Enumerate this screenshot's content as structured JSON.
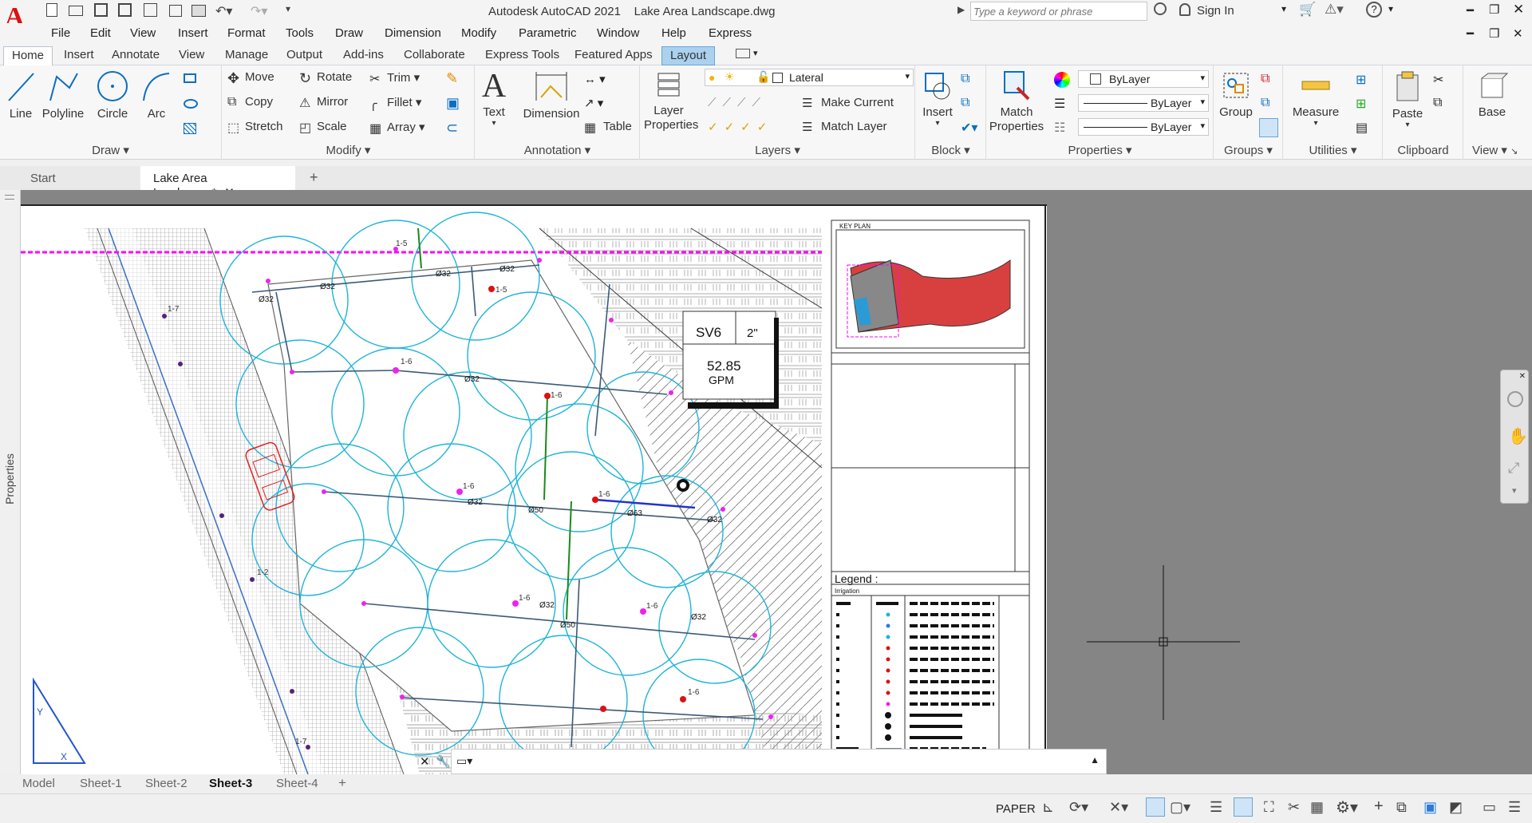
{
  "title_bar": {
    "app_title": "Autodesk AutoCAD 2021",
    "file_name": "Lake Area Landscape.dwg",
    "search_placeholder": "Type a keyword or phrase",
    "sign_in": "Sign In"
  },
  "menu": [
    "File",
    "Edit",
    "View",
    "Insert",
    "Format",
    "Tools",
    "Draw",
    "Dimension",
    "Modify",
    "Parametric",
    "Window",
    "Help",
    "Express"
  ],
  "ribbon_tabs": [
    "Home",
    "Insert",
    "Annotate",
    "View",
    "Manage",
    "Output",
    "Add-ins",
    "Collaborate",
    "Express Tools",
    "Featured Apps",
    "Layout"
  ],
  "ribbon": {
    "draw": {
      "title": "Draw",
      "line": "Line",
      "polyline": "Polyline",
      "circle": "Circle",
      "arc": "Arc"
    },
    "modify": {
      "title": "Modify",
      "move": "Move",
      "rotate": "Rotate",
      "trim": "Trim",
      "copy": "Copy",
      "mirror": "Mirror",
      "fillet": "Fillet",
      "stretch": "Stretch",
      "scale": "Scale",
      "array": "Array"
    },
    "annotation": {
      "title": "Annotation",
      "text": "Text",
      "dimension": "Dimension",
      "table": "Table"
    },
    "layers": {
      "title": "Layers",
      "layer_properties": "Layer Properties",
      "current_layer": "Lateral",
      "make_current": "Make Current",
      "match_layer": "Match Layer"
    },
    "block": {
      "title": "Block",
      "insert": "Insert"
    },
    "properties": {
      "title": "Properties",
      "match_properties": "Match Properties",
      "color": "ByLayer",
      "linetype": "ByLayer",
      "lineweight": "ByLayer"
    },
    "groups": {
      "title": "Groups",
      "group": "Group"
    },
    "utilities": {
      "title": "Utilities",
      "measure": "Measure"
    },
    "clipboard": {
      "title": "Clipboard",
      "paste": "Paste"
    },
    "view": {
      "title": "View",
      "base": "Base"
    }
  },
  "file_tabs": {
    "start": "Start",
    "document": "Lake Area Landscape*"
  },
  "side_panel": "Properties",
  "drawing": {
    "key_plan": "KEY PLAN",
    "legend": "Legend :",
    "legend_sub": "Irrigation",
    "valve_label": "SV6",
    "valve_size": "2\"",
    "flow": "52.85",
    "flow_unit": "GPM",
    "pipe_labels": [
      "Ø32",
      "Ø32",
      "Ø32",
      "Ø32",
      "Ø32",
      "Ø50",
      "Ø50",
      "Ø63",
      "Ø32",
      "Ø32",
      "Ø32",
      "Ø32"
    ],
    "head_labels": [
      "1-5",
      "1-5",
      "1-6",
      "1-6",
      "1-6",
      "1-6",
      "1-6",
      "1-6",
      "1-6",
      "1-7",
      "1-7",
      "1-2"
    ]
  },
  "layout_tabs": [
    "Model",
    "Sheet-1",
    "Sheet-2",
    "Sheet-3",
    "Sheet-4"
  ],
  "status": {
    "space": "PAPER"
  },
  "colors": {
    "accent": "#0a6fc2",
    "sprinkler": "#1eb4d8",
    "boundary": "#ff00ff",
    "ribbon_bg": "#f7f7f7",
    "paper": "#ffffff",
    "workspace": "#858585"
  }
}
